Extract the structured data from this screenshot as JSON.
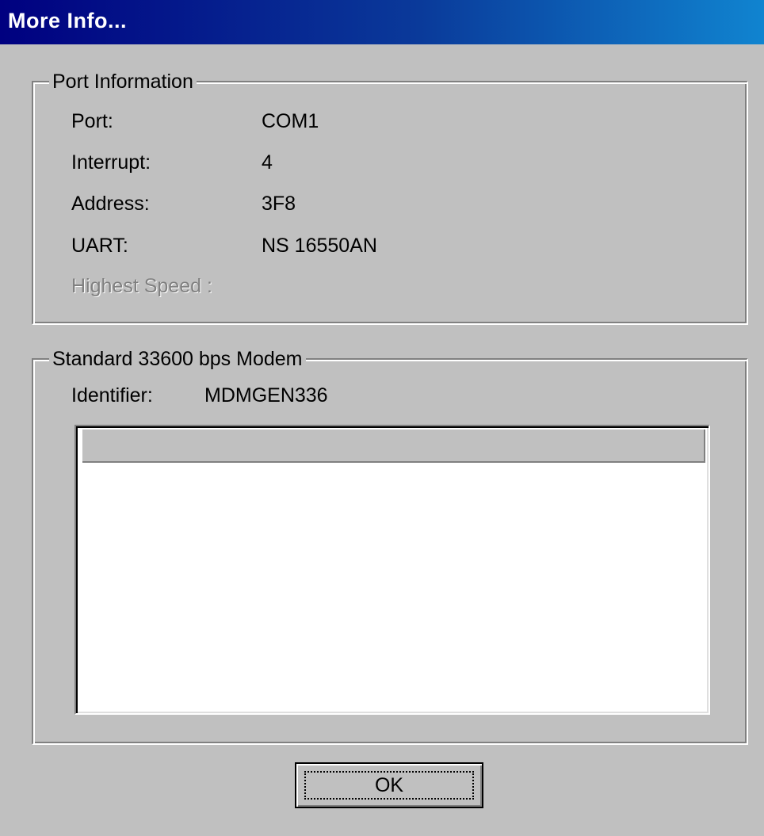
{
  "window": {
    "title": "More Info..."
  },
  "port_info": {
    "legend": "Port Information",
    "rows": [
      {
        "label": "Port:",
        "value": "COM1"
      },
      {
        "label": "Interrupt:",
        "value": "4"
      },
      {
        "label": "Address:",
        "value": "3F8"
      },
      {
        "label": "UART:",
        "value": "NS 16550AN"
      },
      {
        "label": "Highest Speed :",
        "value": ""
      }
    ]
  },
  "modem": {
    "legend": "Standard 33600 bps Modem",
    "identifier_label": "Identifier:",
    "identifier_value": "MDMGEN336"
  },
  "buttons": {
    "ok": "OK"
  },
  "colors": {
    "title_bar_start": "#000080",
    "title_bar_end": "#1084d0",
    "face": "#c0c0c0",
    "disabled_text": "#808080"
  }
}
